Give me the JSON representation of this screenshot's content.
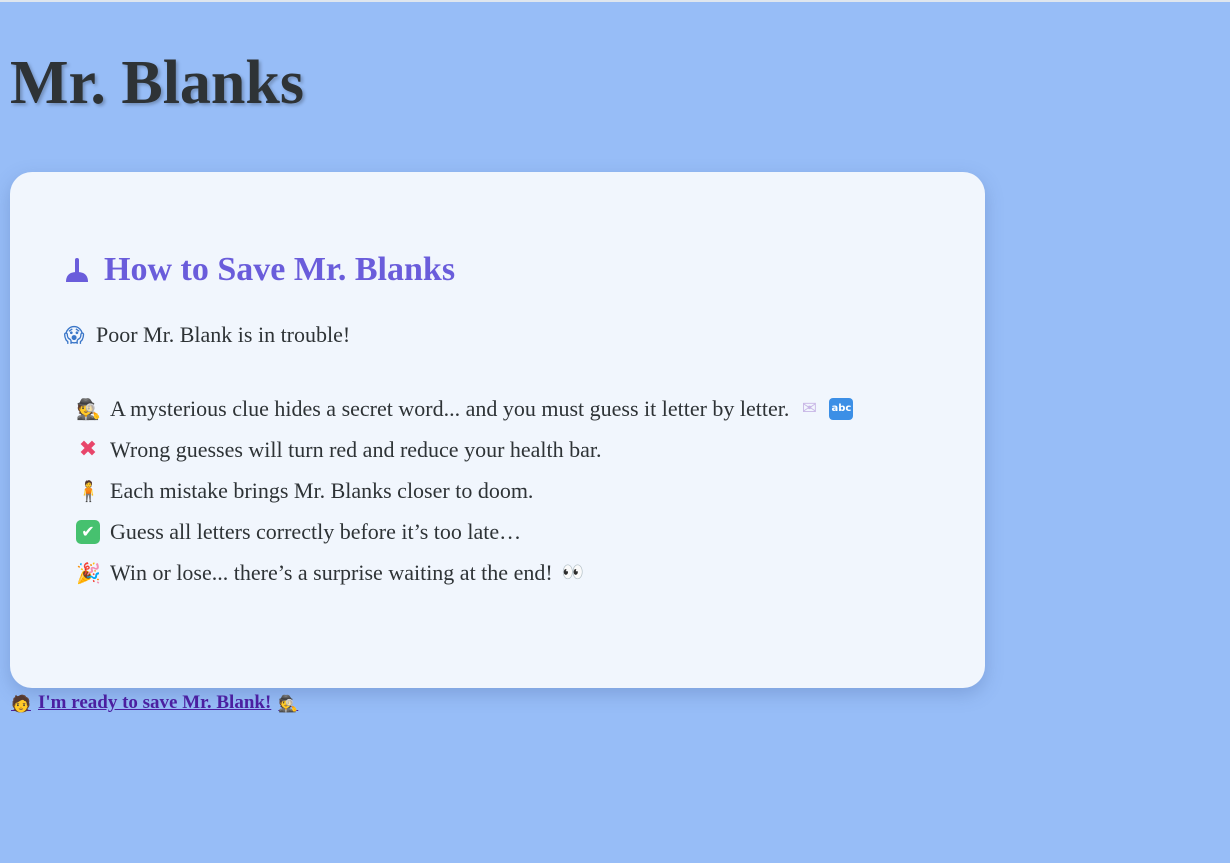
{
  "page": {
    "title": "Mr. Blanks"
  },
  "card": {
    "heading": "How to Save Mr. Blanks",
    "heading_icon": "plunger-icon",
    "intro_icon_glyph": "😱",
    "intro": "Poor Mr. Blank is in trouble!",
    "rules": [
      {
        "icon_glyph": "🕵",
        "icon": "detective-icon",
        "text": "A mysterious clue hides a secret word... and you must guess it letter by letter."
      },
      {
        "icon_glyph": "✖",
        "icon": "x-icon",
        "text": "Wrong guesses will turn red and reduce your health bar."
      },
      {
        "icon_glyph": "🧍",
        "icon": "person-icon",
        "text": "Each mistake brings Mr. Blanks closer to doom."
      },
      {
        "icon_glyph": "✔",
        "icon": "check-icon",
        "text": "Guess all letters correctly before it’s too late…"
      },
      {
        "icon_glyph": "🎉",
        "icon": "party-icon",
        "text": "Win or lose... there’s a surprise waiting at the end!"
      }
    ],
    "rule1_trailing": [
      "✉",
      "abc"
    ],
    "rule5_trailing": "👀"
  },
  "cta": {
    "label": "I'm ready to save Mr. Blank!",
    "lead_glyph": "🧑",
    "trail_glyph": "🕵"
  },
  "colors": {
    "background": "#97bdf7",
    "card": "#f1f6fd",
    "heading": "#6a5ddb",
    "link": "#4b1fa0"
  }
}
